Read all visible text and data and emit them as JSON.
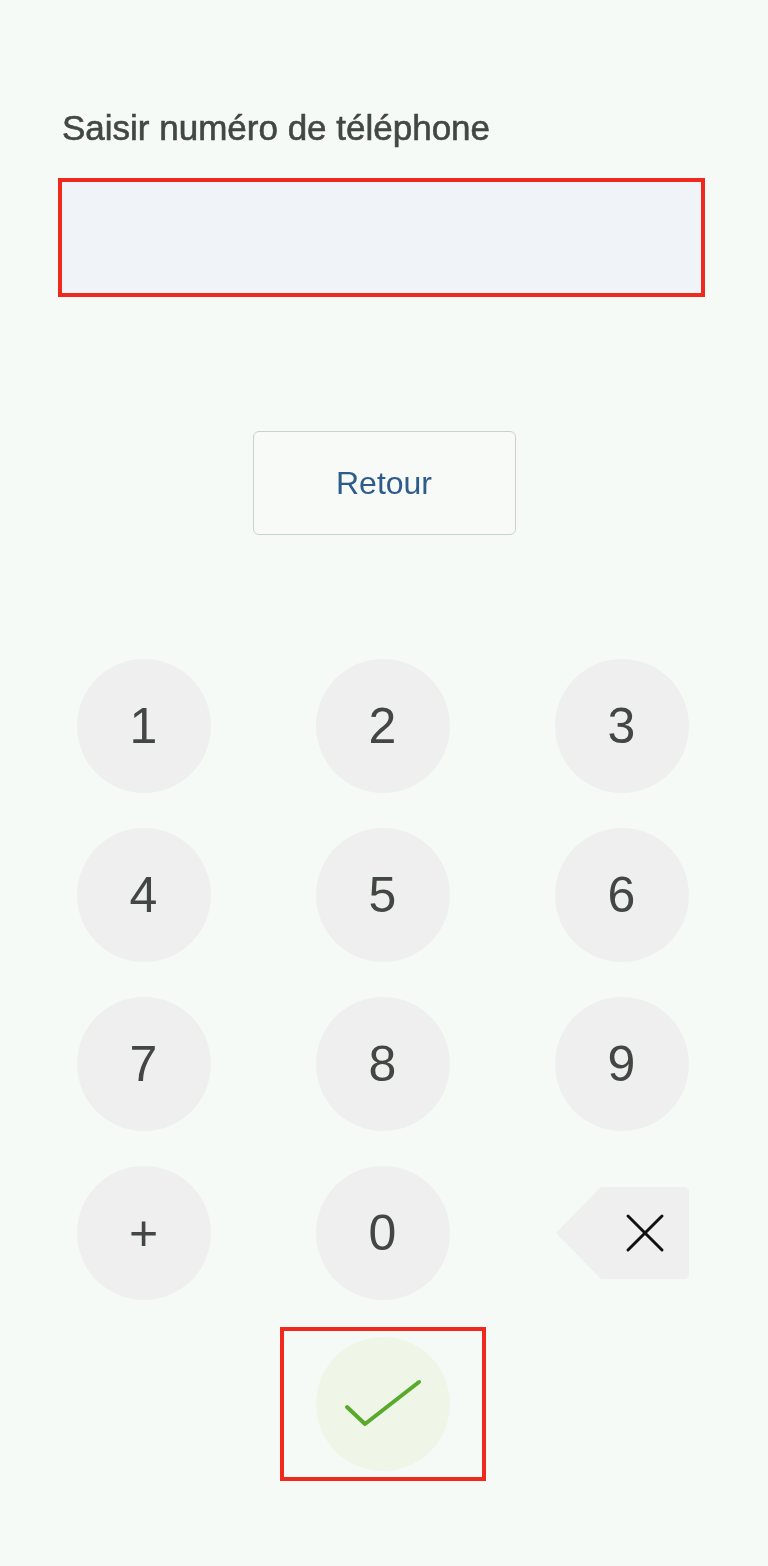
{
  "title": "Saisir numéro de téléphone",
  "phone_field": {
    "highlighted": true
  },
  "back_button": {
    "label": "Retour"
  },
  "keypad": [
    {
      "kind": "key",
      "label": "1"
    },
    {
      "kind": "key",
      "label": "2"
    },
    {
      "kind": "key",
      "label": "3"
    },
    {
      "kind": "key",
      "label": "4"
    },
    {
      "kind": "key",
      "label": "5"
    },
    {
      "kind": "key",
      "label": "6"
    },
    {
      "kind": "key",
      "label": "7"
    },
    {
      "kind": "key",
      "label": "8"
    },
    {
      "kind": "key",
      "label": "9"
    },
    {
      "kind": "key",
      "label": "+"
    },
    {
      "kind": "key",
      "label": "0"
    },
    {
      "kind": "backspace"
    }
  ],
  "confirm_button": {
    "highlighted": true
  }
}
